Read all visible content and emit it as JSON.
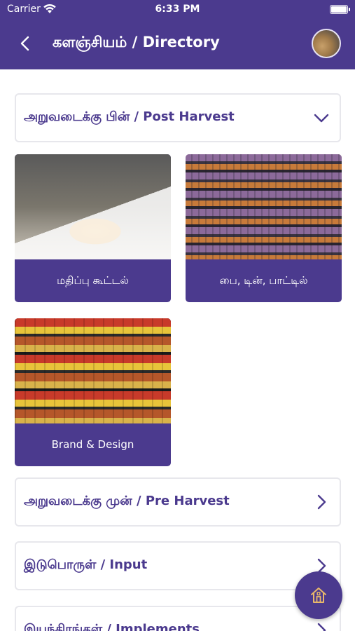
{
  "status_bar": {
    "carrier": "Carrier",
    "time": "6:33 PM"
  },
  "header": {
    "title": "களஞ்சியம் / Directory"
  },
  "sections": {
    "post_harvest": "அறுவடைக்கு பின் / Post Harvest",
    "pre_harvest": "அறுவடைக்கு முன் / Pre Harvest",
    "input": "இடுபொருள் / Input",
    "implements": "இயந்திரங்கள் / Implements"
  },
  "cards": [
    {
      "label": "மதிப்பு கூட்டல்"
    },
    {
      "label": "பை, டின், பாட்டில்"
    },
    {
      "label": "Brand & Design"
    }
  ],
  "icons": {
    "back": "chevron-left-icon",
    "expand": "chevron-down-icon",
    "forward": "chevron-right-icon",
    "home": "home-icon"
  },
  "colors": {
    "primary": "#4b3a8e",
    "home_icon": "#e8b86a"
  }
}
